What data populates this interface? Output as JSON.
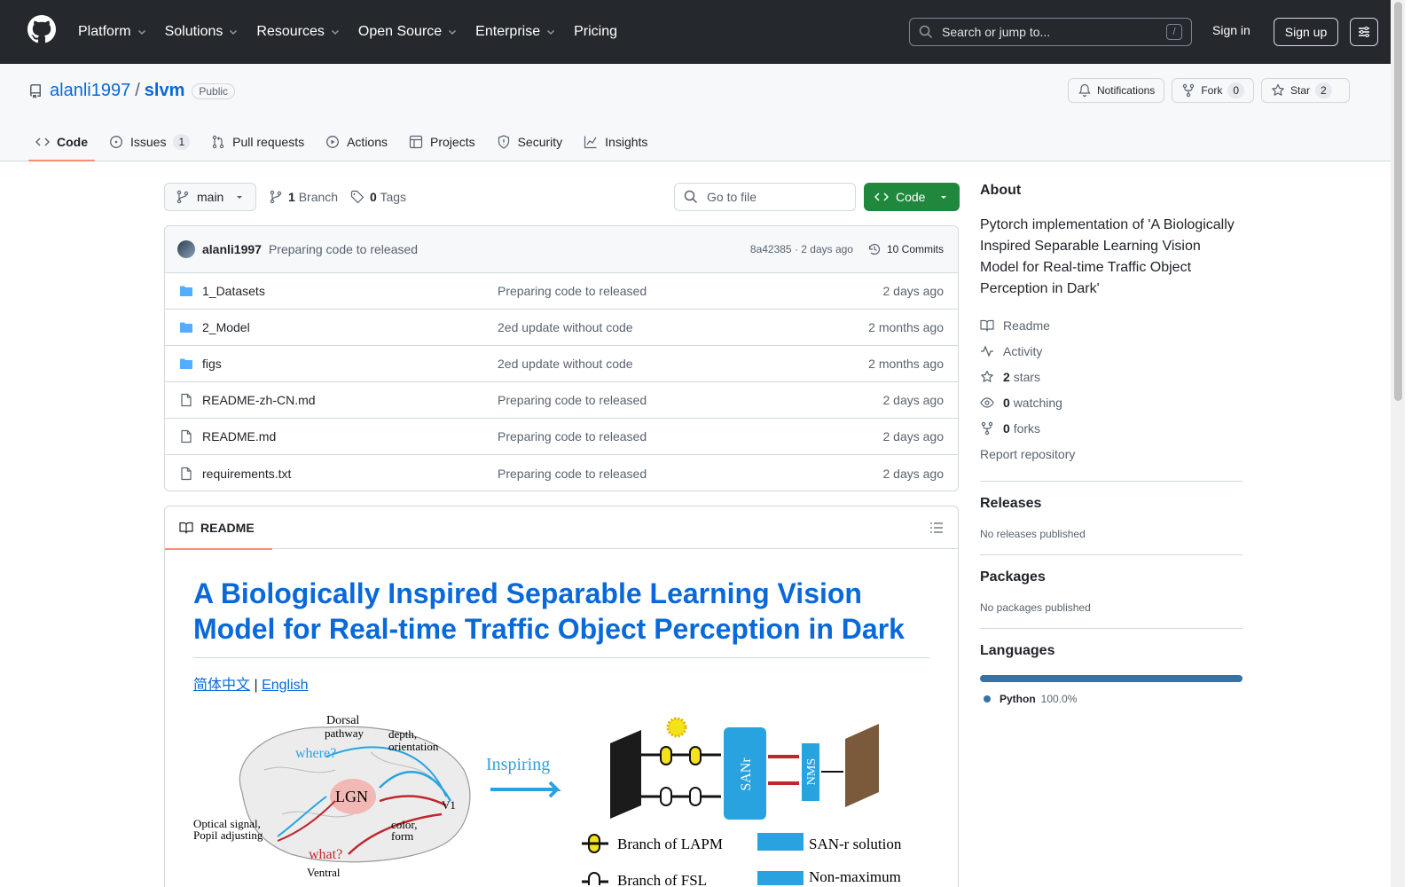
{
  "header": {
    "nav": [
      "Platform",
      "Solutions",
      "Resources",
      "Open Source",
      "Enterprise"
    ],
    "pricing": "Pricing",
    "search_placeholder": "Search or jump to...",
    "search_key": "/",
    "signin": "Sign in",
    "signup": "Sign up"
  },
  "repo": {
    "owner": "alanli1997",
    "sep": "/",
    "name": "slvm",
    "visibility": "Public",
    "notifications": "Notifications",
    "fork_label": "Fork",
    "fork_count": "0",
    "star_label": "Star",
    "star_count": "2",
    "tabs": [
      {
        "label": "Code"
      },
      {
        "label": "Issues",
        "count": "1"
      },
      {
        "label": "Pull requests"
      },
      {
        "label": "Actions"
      },
      {
        "label": "Projects"
      },
      {
        "label": "Security"
      },
      {
        "label": "Insights"
      }
    ]
  },
  "files": {
    "branch": "main",
    "branch_count": "1",
    "branch_label": "Branch",
    "tag_count": "0",
    "tag_label": "Tags",
    "goto_placeholder": "Go to file",
    "code_button": "Code",
    "commit": {
      "author": "alanli1997",
      "message": "Preparing code to released",
      "hash_age": "8a42385 · 2 days ago",
      "commits": "10 Commits"
    },
    "rows": [
      {
        "name": "1_Datasets",
        "type": "folder",
        "commit": "Preparing code to released",
        "age": "2 days ago"
      },
      {
        "name": "2_Model",
        "type": "folder",
        "commit": "2ed update without code",
        "age": "2 months ago"
      },
      {
        "name": "figs",
        "type": "folder",
        "commit": "2ed update without code",
        "age": "2 months ago"
      },
      {
        "name": "README-zh-CN.md",
        "type": "file",
        "commit": "Preparing code to released",
        "age": "2 days ago"
      },
      {
        "name": "README.md",
        "type": "file",
        "commit": "Preparing code to released",
        "age": "2 days ago"
      },
      {
        "name": "requirements.txt",
        "type": "file",
        "commit": "Preparing code to released",
        "age": "2 days ago"
      }
    ]
  },
  "readme": {
    "tab": "README",
    "title": "A Biologically Inspired Separable Learning Vision Model for Real-time Traffic Object Perception in Dark",
    "lang_zh": "简体中文",
    "lang_sep": "|",
    "lang_en": "English",
    "figure": {
      "dorsal": "Dorsal",
      "pathway": "pathway",
      "depth": "depth,",
      "orientation": "orientation",
      "where": "where?",
      "lgn": "LGN",
      "v1": "V1",
      "optical1": "Optical signal,",
      "optical2": "Popil adjusting",
      "color": "color,",
      "form": "form",
      "what": "what?",
      "ventral": "Ventral",
      "inspiring": "Inspiring",
      "sanr": "SANr",
      "nms": "NMS",
      "legend_lapm": "Branch of LAPM",
      "legend_sanr": "SAN-r solution",
      "legend_fsl": "Branch of FSL",
      "legend_nms": "Non-maximum"
    }
  },
  "sidebar": {
    "about_title": "About",
    "about_text": "Pytorch implementation of 'A Biologically Inspired Separable Learning Vision Model for Real-time Traffic Object Perception in Dark'",
    "readme": "Readme",
    "activity": "Activity",
    "stars_count": "2",
    "stars_label": "stars",
    "watching_count": "0",
    "watching_label": "watching",
    "forks_count": "0",
    "forks_label": "forks",
    "report": "Report repository",
    "releases_title": "Releases",
    "releases_text": "No releases published",
    "packages_title": "Packages",
    "packages_text": "No packages published",
    "languages_title": "Languages",
    "language": "Python",
    "language_pct": "100.0%",
    "language_fraction": 1.0,
    "language_color": "#3572A5"
  },
  "colors": {
    "header_bg": "#25292e",
    "link": "#0969da",
    "green": "#1f883d",
    "tab_underline": "#fd8c73"
  }
}
